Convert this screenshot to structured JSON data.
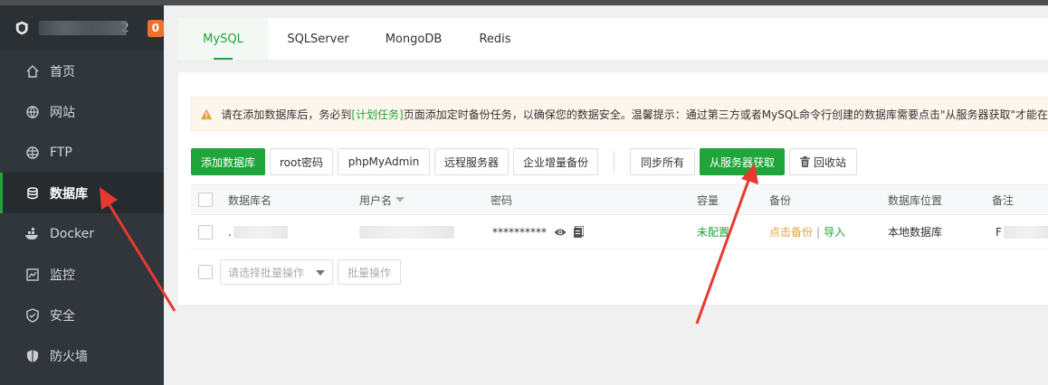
{
  "brand": {
    "name_tail": "2",
    "badge": "0"
  },
  "sidebar": {
    "items": [
      {
        "label": "首页",
        "icon": "home-icon"
      },
      {
        "label": "网站",
        "icon": "globe-icon"
      },
      {
        "label": "FTP",
        "icon": "ftp-icon"
      },
      {
        "label": "数据库",
        "icon": "database-icon",
        "active": true
      },
      {
        "label": "Docker",
        "icon": "docker-icon"
      },
      {
        "label": "监控",
        "icon": "monitor-icon"
      },
      {
        "label": "安全",
        "icon": "shield-icon"
      },
      {
        "label": "防火墙",
        "icon": "firewall-icon"
      }
    ]
  },
  "tabs": [
    {
      "label": "MySQL",
      "active": true
    },
    {
      "label": "SQLServer"
    },
    {
      "label": "MongoDB"
    },
    {
      "label": "Redis"
    }
  ],
  "notice": {
    "prefix": "请在添加数据库后，务必到",
    "link": "[计划任务]",
    "suffix": "页面添加定时备份任务，以确保您的数据安全。温馨提示：通过第三方或者MySQL命令行创建的数据库需要点击\"从服务器获取\"才能在"
  },
  "toolbar": {
    "add_db": "添加数据库",
    "root_pwd": "root密码",
    "phpmyadmin": "phpMyAdmin",
    "remote": "远程服务器",
    "incremental": "企业增量备份",
    "sync_all": "同步所有",
    "fetch_server": "从服务器获取",
    "recycle": "回收站"
  },
  "table": {
    "headers": {
      "name": "数据库名",
      "user": "用户名",
      "password": "密码",
      "capacity": "容量",
      "backup": "备份",
      "location": "数据库位置",
      "remark": "备注"
    },
    "row": {
      "name_mark": ".",
      "password": "**********",
      "capacity": "未配置",
      "backup_link": "点击备份",
      "import_link": "导入",
      "location": "本地数据库",
      "remark_mark": "F"
    }
  },
  "footer": {
    "batch_placeholder": "请选择批量操作",
    "batch_button": "批量操作"
  },
  "colors": {
    "accent": "#20a53a",
    "sidebar": "#30363b",
    "badge": "#f0702d",
    "arrow": "#e8392f"
  }
}
